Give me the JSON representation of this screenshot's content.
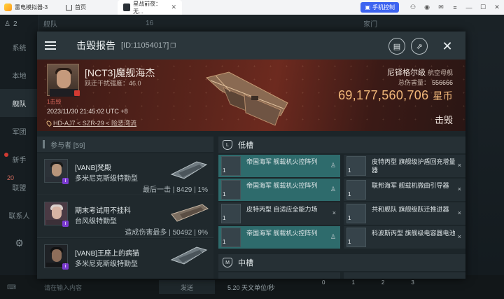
{
  "emulator": {
    "app_name": "雷电模拟器-3",
    "tabs": [
      {
        "label": "首页"
      },
      {
        "label": "星战前夜：无..."
      }
    ],
    "remote_label": "手机控制"
  },
  "sidebar": {
    "top_count": "2",
    "items": [
      {
        "label": "系统"
      },
      {
        "label": "本地"
      },
      {
        "label": "舰队"
      },
      {
        "label": "军团"
      },
      {
        "label": "新手"
      },
      {
        "label": "联盟"
      },
      {
        "label": "联系人"
      }
    ],
    "badge": "20"
  },
  "background": {
    "top_label": "舰队",
    "top_count": "16",
    "top_right": "家门",
    "chat_placeholder": "请在输入内容",
    "send_label": "发送",
    "speed": "5.20 天文单位/秒",
    "hotkeys": [
      "0",
      "1",
      "2",
      "3"
    ]
  },
  "report": {
    "title": "击毁报告",
    "id": "[ID:11054017]",
    "victim": {
      "name": "[NCT3]魔舰海杰",
      "security_label": "跃迁干扰强度：",
      "security_value": "46.0",
      "kills": "1击毁",
      "date": "2023/11/30 21:45:02 UTC +8",
      "location": "HD-AJ7 < SZR-29 < 险恶湾流"
    },
    "ship": {
      "name": "尼铎格尔级",
      "class": "航空母舰",
      "damage_label": "总伤害量：",
      "damage_value": "556666",
      "value": "69,177,560,706",
      "unit": "星币",
      "result": "击毁"
    },
    "participants_label": "参与者 [59]",
    "participants": [
      {
        "name": "[VANB]梵殿",
        "ship": "多米尼克斯级特勤型",
        "stat_label": "最后一击",
        "damage": "8429",
        "percent": "1%"
      },
      {
        "name": "期末考试用不挂科",
        "ship": "台风级特勤型",
        "stat_label": "造成伤害最多",
        "damage": "50492",
        "percent": "9%"
      },
      {
        "name": "[VANB]王座上的病猫",
        "ship": "多米尼克斯级特勤型",
        "stat_label": "",
        "damage": "",
        "percent": ""
      }
    ],
    "low_slot_label": "低槽",
    "mid_slot_label": "中槽",
    "low_slots": [
      {
        "name": "帝国海军 舰载机火控阵列",
        "qty": "1",
        "status": "person",
        "highlight": true
      },
      {
        "name": "皮特丙型 旗舰级护盾回充增量器",
        "qty": "1",
        "status": "×",
        "highlight": false
      },
      {
        "name": "帝国海军 舰载机火控阵列",
        "qty": "1",
        "status": "person",
        "highlight": true
      },
      {
        "name": "联邦海军 舰载机微曲引导器",
        "qty": "1",
        "status": "×",
        "highlight": false
      },
      {
        "name": "皮特丙型 自适应全能力场",
        "qty": "1",
        "status": "×",
        "highlight": false
      },
      {
        "name": "共和舰队 旗舰级跃迁推进器",
        "qty": "1",
        "status": "×",
        "highlight": false
      },
      {
        "name": "帝国海军 舰载机火控阵列",
        "qty": "1",
        "status": "person",
        "highlight": true
      },
      {
        "name": "科波斯丙型 旗舰级电容器电池",
        "qty": "1",
        "status": "×",
        "highlight": false
      }
    ]
  },
  "colors": {
    "accent_value": "#f2b87a",
    "highlight_row": "#2e6b6c",
    "participant_tag": "#7b3bd1",
    "alert_red": "#d23a32"
  }
}
